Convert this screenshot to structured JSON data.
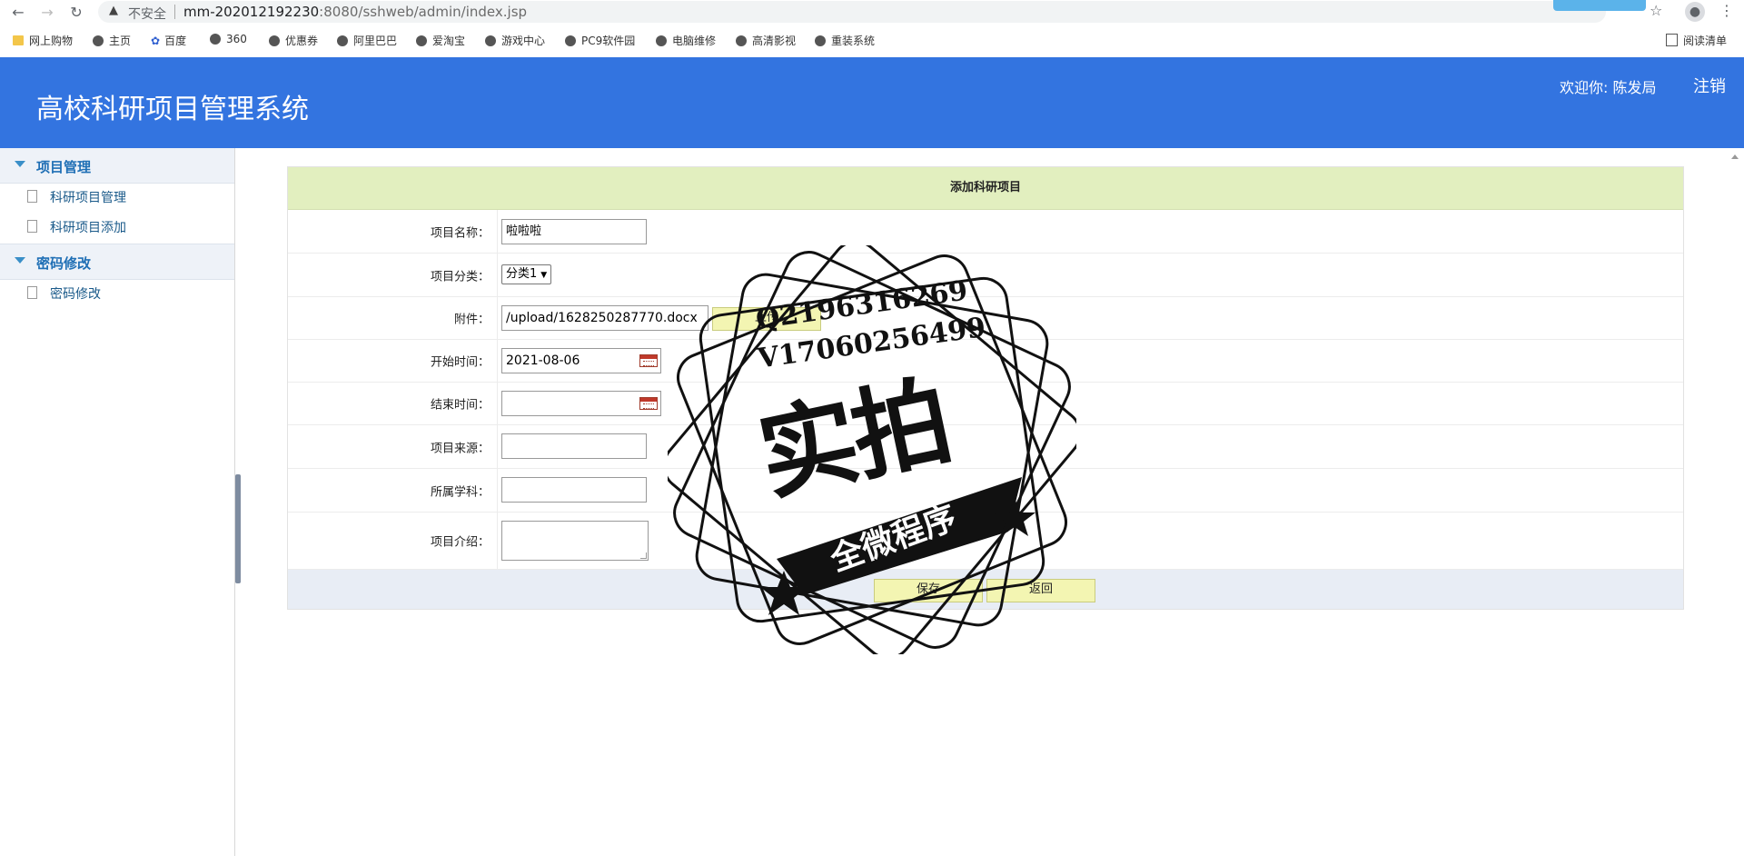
{
  "browser": {
    "insecure_label": "不安全",
    "url_host": "mm-202012192230",
    "url_rest": ":8080/sshweb/admin/index.jsp",
    "bookmarks": [
      "网上购物",
      "主页",
      "百度",
      "360",
      "优惠券",
      "阿里巴巴",
      "爱淘宝",
      "游戏中心",
      "PC9软件园",
      "电脑维修",
      "高清影视",
      "重装系统"
    ],
    "reading_list": "阅读清单"
  },
  "header": {
    "title": "高校科研项目管理系统",
    "welcome": "欢迎你: 陈发局",
    "logout": "注销",
    "accent_color": "#3374e0"
  },
  "sidebar": {
    "groups": [
      {
        "label": "项目管理",
        "items": [
          "科研项目管理",
          "科研项目添加"
        ]
      },
      {
        "label": "密码修改",
        "items": [
          "密码修改"
        ]
      }
    ]
  },
  "form": {
    "title": "添加科研项目",
    "fields": {
      "name": {
        "label": "项目名称：",
        "value": "啦啦啦"
      },
      "category": {
        "label": "项目分类：",
        "value": "分类1"
      },
      "attachment": {
        "label": "附件：",
        "value": "/upload/1628250287770.docx",
        "upload_label": "上传"
      },
      "start": {
        "label": "开始时间：",
        "value": "2021-08-06"
      },
      "end": {
        "label": "结束时间：",
        "value": ""
      },
      "source": {
        "label": "项目来源：",
        "value": ""
      },
      "discipline": {
        "label": "所属学科：",
        "value": ""
      },
      "intro": {
        "label": "项目介绍：",
        "value": ""
      }
    },
    "save_label": "保存",
    "back_label": "返回"
  },
  "watermark": {
    "line1": "Q2196316269",
    "line2": "V17060256499",
    "big": "实拍",
    "ribbon": "全微程序"
  }
}
